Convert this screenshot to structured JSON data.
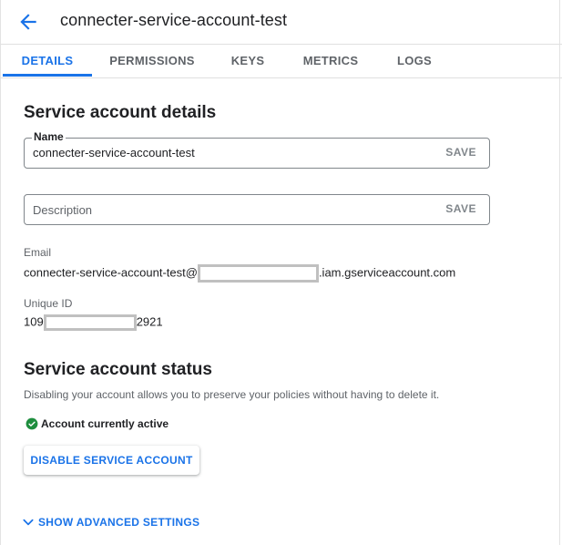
{
  "header": {
    "title": "connecter-service-account-test",
    "back_icon": "arrow-back-icon"
  },
  "tabs": [
    {
      "label": "DETAILS",
      "active": true
    },
    {
      "label": "PERMISSIONS",
      "active": false
    },
    {
      "label": "KEYS",
      "active": false
    },
    {
      "label": "METRICS",
      "active": false
    },
    {
      "label": "LOGS",
      "active": false
    }
  ],
  "details": {
    "heading": "Service account details",
    "name_label": "Name",
    "name_value": "connecter-service-account-test",
    "name_save": "SAVE",
    "description_placeholder": "Description",
    "description_save": "SAVE",
    "email_label": "Email",
    "email_prefix": "connecter-service-account-test@",
    "email_suffix": ".iam.gserviceaccount.com",
    "unique_id_label": "Unique ID",
    "unique_id_prefix": "109",
    "unique_id_suffix": "2921"
  },
  "status": {
    "heading": "Service account status",
    "description": "Disabling your account allows you to preserve your policies without having to delete it.",
    "state_text": "Account currently active",
    "state_icon": "check-circle-icon",
    "disable_button": "DISABLE SERVICE ACCOUNT"
  },
  "advanced": {
    "label": "SHOW ADVANCED SETTINGS",
    "icon": "chevron-down-icon"
  },
  "colors": {
    "accent": "#1a73e8",
    "success": "#1e8e3e",
    "redaction_border": "#c0c0c0"
  }
}
